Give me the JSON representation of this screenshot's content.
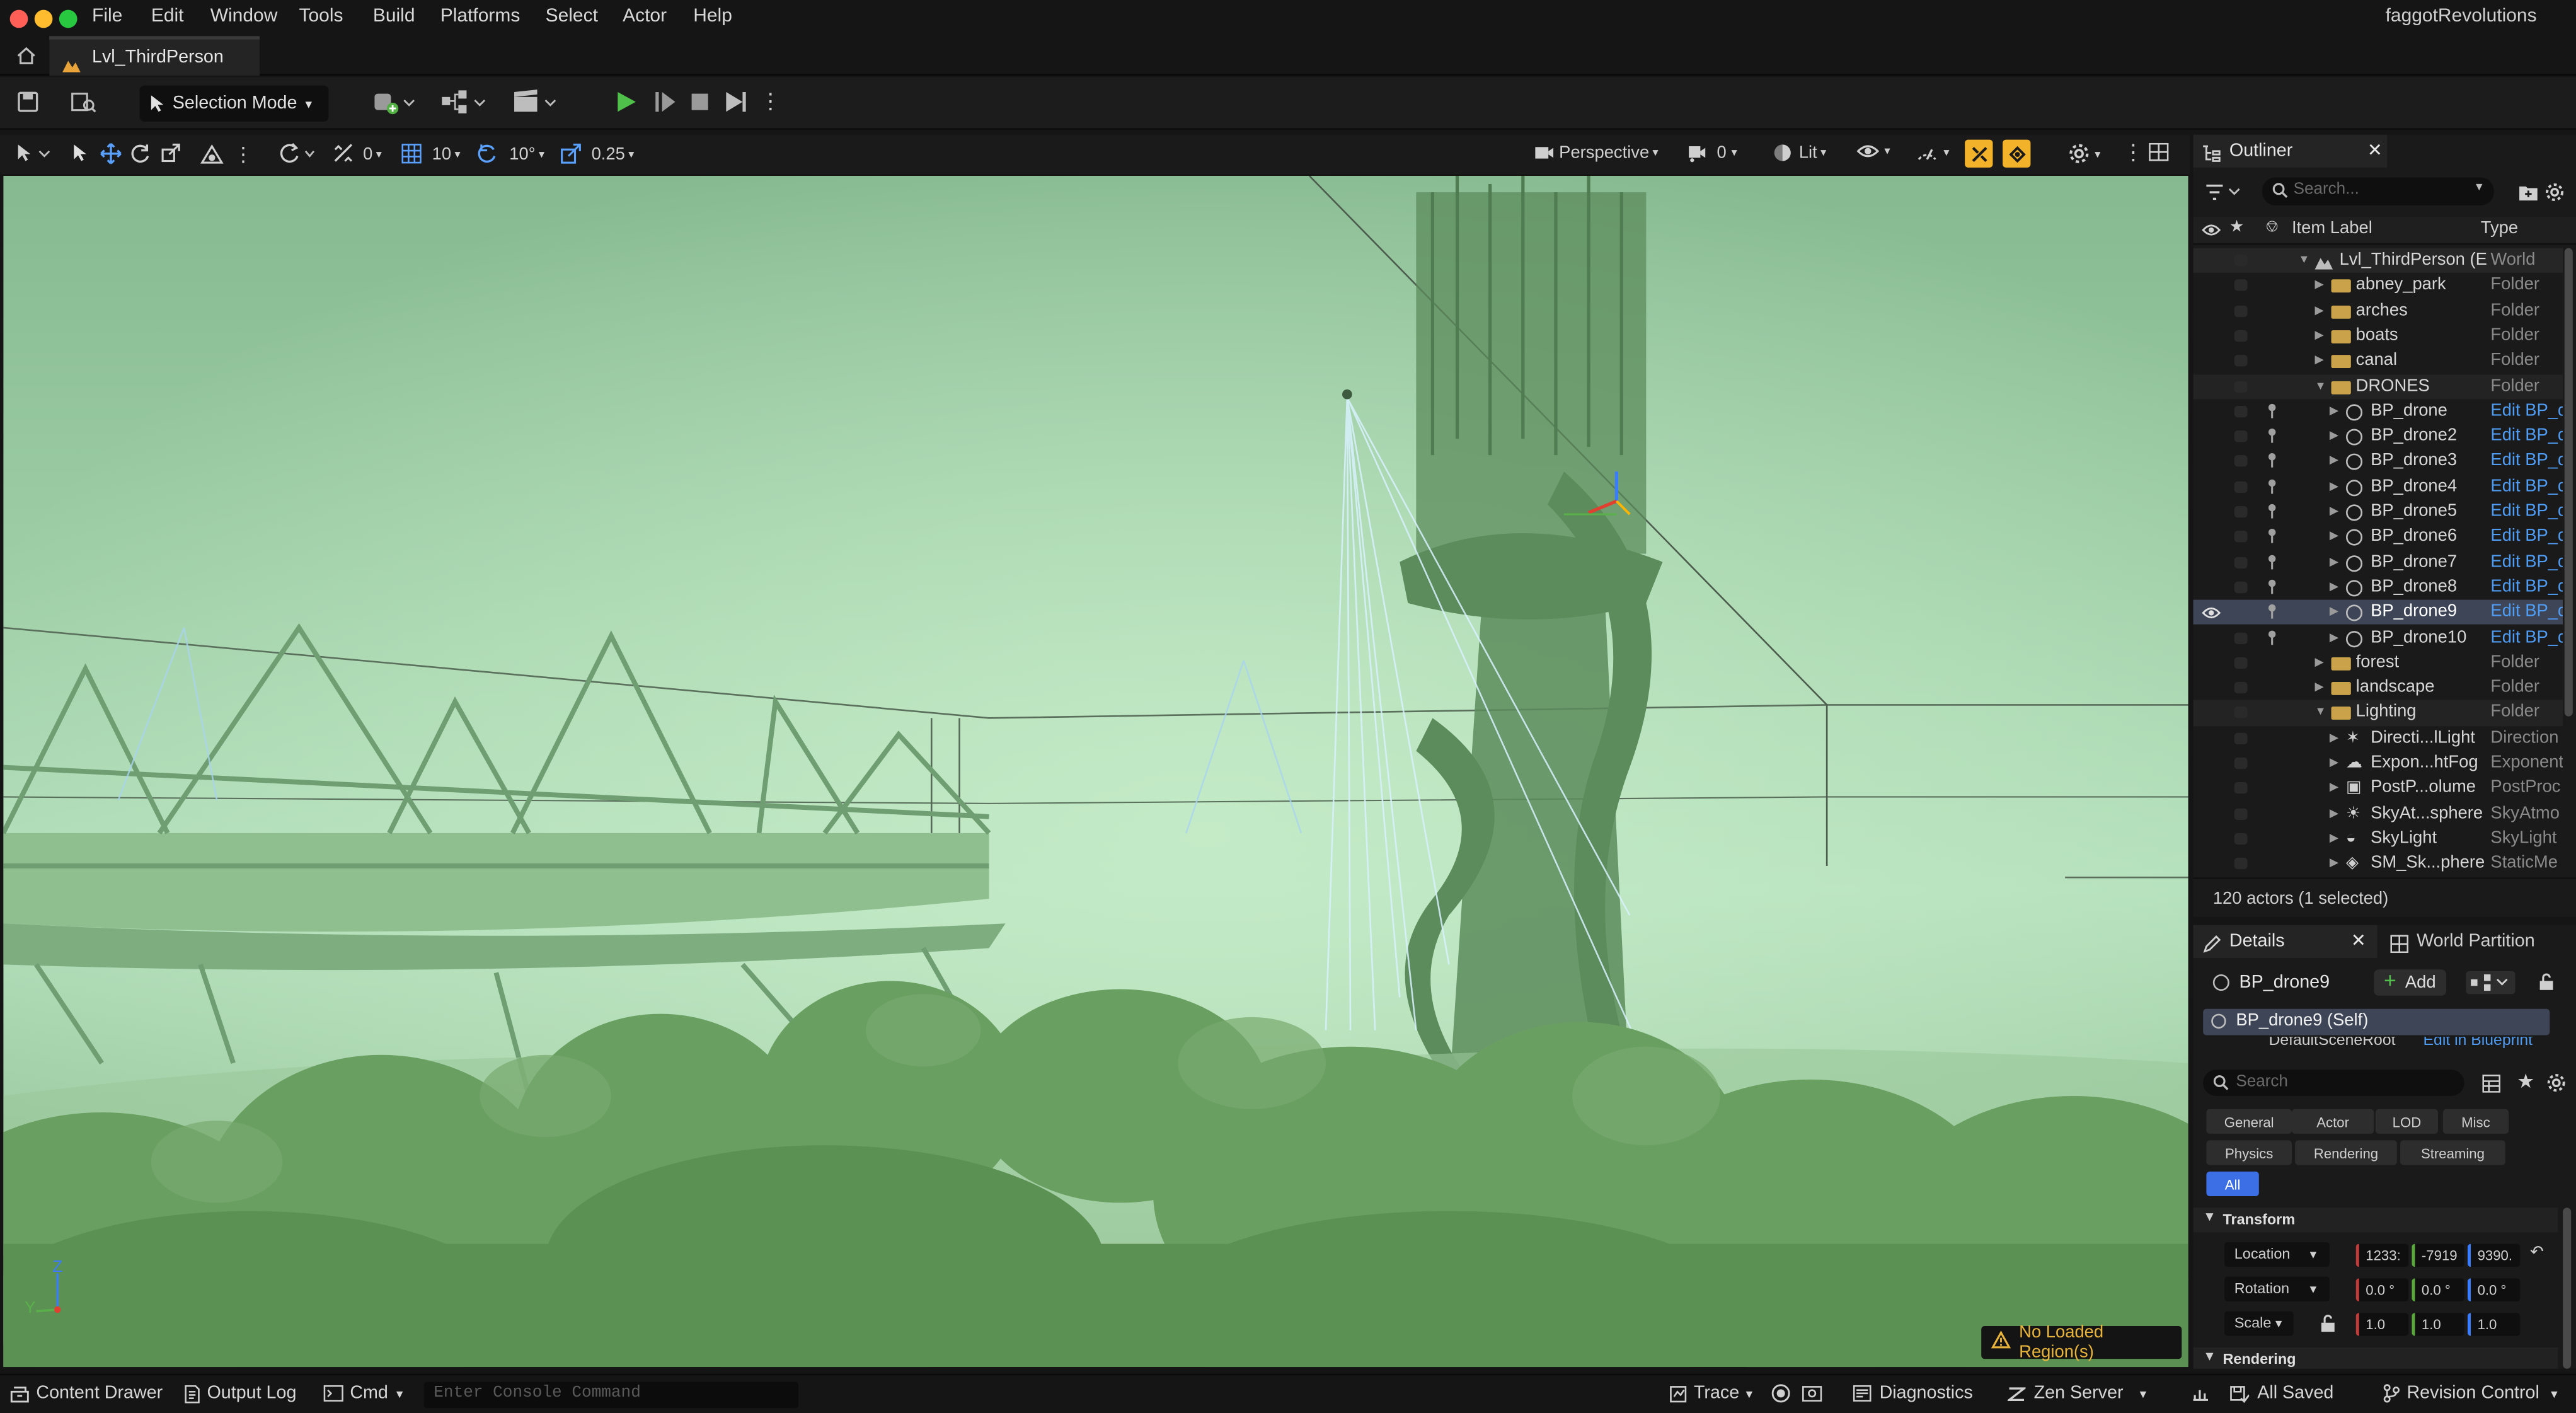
{
  "menubar": {
    "items": [
      "File",
      "Edit",
      "Window",
      "Tools",
      "Build",
      "Platforms",
      "Select",
      "Actor",
      "Help"
    ],
    "project_name": "faggotRevolutions",
    "traffic_colors": [
      "#ff5f57",
      "#febc2e",
      "#28c840"
    ]
  },
  "tab": {
    "label": "Lvl_ThirdPerson"
  },
  "toolbar": {
    "selection_mode": "Selection Mode"
  },
  "viewport_bar": {
    "translate_snap": "0",
    "grid_snap": "10",
    "rotate_snap": "10°",
    "scale_snap": "0.25",
    "view_mode": "Perspective",
    "camera_speed": "0",
    "lighting": "Lit",
    "accent": "#f2b22a"
  },
  "viewport": {
    "axis_z": "Z",
    "axis_y": "Y",
    "status": "No Loaded Region(s)",
    "status_color": "#e8b33a"
  },
  "outliner": {
    "title": "Outliner",
    "search_placeholder": "Search...",
    "col_label": "Item Label",
    "col_type": "Type",
    "rows": [
      {
        "label": "Lvl_ThirdPerson (E",
        "type": "World",
        "kind": "world",
        "depth": 0,
        "expanded": true
      },
      {
        "label": "abney_park",
        "type": "Folder",
        "kind": "folder",
        "depth": 1
      },
      {
        "label": "arches",
        "type": "Folder",
        "kind": "folder",
        "depth": 1
      },
      {
        "label": "boats",
        "type": "Folder",
        "kind": "folder",
        "depth": 1
      },
      {
        "label": "canal",
        "type": "Folder",
        "kind": "folder",
        "depth": 1
      },
      {
        "label": "DRONES",
        "type": "Folder",
        "kind": "folder",
        "depth": 1,
        "expanded": true
      },
      {
        "label": "BP_drone",
        "type": "Edit BP_d",
        "kind": "actor",
        "depth": 2,
        "link": true
      },
      {
        "label": "BP_drone2",
        "type": "Edit BP_d",
        "kind": "actor",
        "depth": 2,
        "link": true
      },
      {
        "label": "BP_drone3",
        "type": "Edit BP_d",
        "kind": "actor",
        "depth": 2,
        "link": true
      },
      {
        "label": "BP_drone4",
        "type": "Edit BP_d",
        "kind": "actor",
        "depth": 2,
        "link": true
      },
      {
        "label": "BP_drone5",
        "type": "Edit BP_d",
        "kind": "actor",
        "depth": 2,
        "link": true
      },
      {
        "label": "BP_drone6",
        "type": "Edit BP_d",
        "kind": "actor",
        "depth": 2,
        "link": true
      },
      {
        "label": "BP_drone7",
        "type": "Edit BP_d",
        "kind": "actor",
        "depth": 2,
        "link": true
      },
      {
        "label": "BP_drone8",
        "type": "Edit BP_d",
        "kind": "actor",
        "depth": 2,
        "link": true
      },
      {
        "label": "BP_drone9",
        "type": "Edit BP_d",
        "kind": "actor",
        "depth": 2,
        "link": true,
        "selected": true
      },
      {
        "label": "BP_drone10",
        "type": "Edit BP_d",
        "kind": "actor",
        "depth": 2,
        "link": true
      },
      {
        "label": "forest",
        "type": "Folder",
        "kind": "folder",
        "depth": 1
      },
      {
        "label": "landscape",
        "type": "Folder",
        "kind": "folder",
        "depth": 1
      },
      {
        "label": "Lighting",
        "type": "Folder",
        "kind": "folder",
        "depth": 1,
        "expanded": true
      },
      {
        "label": "Directi...lLight",
        "type": "Direction",
        "kind": "light",
        "depth": 2
      },
      {
        "label": "Expon...htFog",
        "type": "Exponent",
        "kind": "fog",
        "depth": 2
      },
      {
        "label": "PostP...olume",
        "type": "PostProc",
        "kind": "volume",
        "depth": 2
      },
      {
        "label": "SkyAt...sphere",
        "type": "SkyAtmo",
        "kind": "sky",
        "depth": 2
      },
      {
        "label": "SkyLight",
        "type": "SkyLight",
        "kind": "skylight",
        "depth": 2
      },
      {
        "label": "SM_Sk...phere",
        "type": "StaticMe",
        "kind": "mesh",
        "depth": 2
      }
    ],
    "footer": "120 actors (1 selected)"
  },
  "details": {
    "tab_details": "Details",
    "tab_world": "World Partition",
    "actor_name": "BP_drone9",
    "add_label": "Add",
    "self_label": "BP_drone9 (Self)",
    "component_label": "DefaultSceneRoot",
    "component_link": "Edit in Blueprint",
    "search_placeholder": "Search",
    "filters_row1": [
      "General",
      "Actor",
      "LOD",
      "Misc"
    ],
    "filters_row2": [
      "Physics",
      "Rendering",
      "Streaming"
    ],
    "filter_all": "All",
    "section_transform": "Transform",
    "location_label": "Location",
    "rotation_label": "Rotation",
    "scale_label": "Scale",
    "location": [
      "1233:",
      "-7919",
      "9390."
    ],
    "rotation": [
      "0.0 °",
      "0.0 °",
      "0.0 °"
    ],
    "scale": [
      "1.0",
      "1.0",
      "1.0"
    ],
    "section_rendering": "Rendering"
  },
  "bottom": {
    "content_drawer": "Content Drawer",
    "output_log": "Output Log",
    "cmd": "Cmd",
    "console_placeholder": "Enter Console Command",
    "trace": "Trace",
    "diagnostics": "Diagnostics",
    "zen_server": "Zen Server",
    "all_saved": "All Saved",
    "revision_control": "Revision Control"
  }
}
